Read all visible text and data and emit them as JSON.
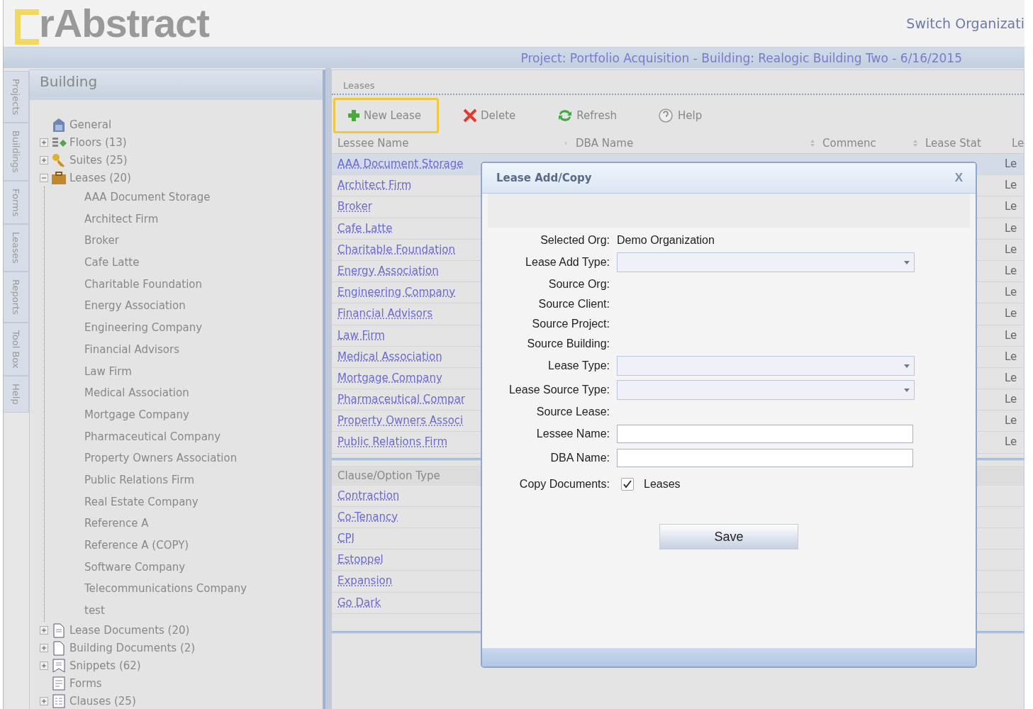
{
  "header": {
    "logo": "rAbstract",
    "switch_link": "Switch Organizati"
  },
  "project_bar": {
    "text": "Project: Portfolio Acquisition - Building: Realogic Building Two - 6/16/2015"
  },
  "side_tabs": [
    {
      "label": "Projects",
      "selected": false
    },
    {
      "label": "Buildings",
      "selected": false
    },
    {
      "label": "Forms",
      "selected": false
    },
    {
      "label": "Leases",
      "selected": false
    },
    {
      "label": "Reports",
      "selected": false
    },
    {
      "label": "Tool Box",
      "selected": false
    },
    {
      "label": "Help",
      "selected": false
    }
  ],
  "building_panel": {
    "title": "Building",
    "tree": [
      {
        "label": "General"
      },
      {
        "label": "Floors (13)",
        "expanded": false
      },
      {
        "label": "Suites (25)",
        "expanded": false
      },
      {
        "label": "Leases (20)",
        "expanded": true,
        "children": [
          {
            "label": "AAA Document Storage"
          },
          {
            "label": "Architect Firm"
          },
          {
            "label": "Broker"
          },
          {
            "label": "Cafe Latte"
          },
          {
            "label": "Charitable Foundation"
          },
          {
            "label": "Energy Association"
          },
          {
            "label": "Engineering Company"
          },
          {
            "label": "Financial Advisors"
          },
          {
            "label": "Law Firm"
          },
          {
            "label": "Medical Association"
          },
          {
            "label": "Mortgage Company"
          },
          {
            "label": "Pharmaceutical Company"
          },
          {
            "label": "Property Owners Association"
          },
          {
            "label": "Public Relations Firm"
          },
          {
            "label": "Real Estate Company"
          },
          {
            "label": "Reference A"
          },
          {
            "label": "Reference A (COPY)"
          },
          {
            "label": "Software Company"
          },
          {
            "label": "Telecommunications Company"
          },
          {
            "label": "test"
          }
        ]
      },
      {
        "label": "Lease Documents (20)",
        "expanded": false
      },
      {
        "label": "Building Documents (2)",
        "expanded": false
      },
      {
        "label": "Snippets (62)",
        "expanded": false
      },
      {
        "label": "Forms"
      },
      {
        "label": "Clauses (25)",
        "expanded": false
      }
    ]
  },
  "leases_panel": {
    "title": "Leases",
    "toolbar": [
      {
        "label": "New Lease",
        "highlighted": true
      },
      {
        "label": "Delete",
        "highlighted": false
      },
      {
        "label": "Refresh",
        "highlighted": false
      },
      {
        "label": "Help",
        "highlighted": false
      }
    ],
    "columns": [
      "Lessee Name",
      "DBA Name",
      "Commenc",
      "Lease Stat",
      "Le"
    ],
    "rows": [
      {
        "lessee": "AAA Document Storage",
        "column_5": "Le",
        "selected": true
      },
      {
        "lessee": "Architect Firm",
        "column_5": "Le",
        "selected": false
      },
      {
        "lessee": "Broker",
        "column_5": "Le",
        "selected": false
      },
      {
        "lessee": "Cafe Latte",
        "column_5": "Le",
        "selected": false
      },
      {
        "lessee": "Charitable Foundation",
        "column_5": "Le",
        "selected": false
      },
      {
        "lessee": "Energy Association",
        "column_5": "Le",
        "selected": false
      },
      {
        "lessee": "Engineering Company",
        "column_5": "Le",
        "selected": false
      },
      {
        "lessee": "Financial Advisors",
        "column_5": "Le",
        "selected": false
      },
      {
        "lessee": "Law Firm",
        "column_5": "Le",
        "selected": false
      },
      {
        "lessee": "Medical Association",
        "column_5": "Le",
        "selected": false
      },
      {
        "lessee": "Mortgage Company",
        "column_5": "Le",
        "selected": false
      },
      {
        "lessee": "Pharmaceutical Compar",
        "column_5": "Le",
        "selected": false
      },
      {
        "lessee": "Property Owners Associ",
        "column_5": "Le",
        "selected": false
      },
      {
        "lessee": "Public Relations Firm",
        "column_5": "Le",
        "selected": false
      }
    ],
    "clause_grid": {
      "column": "Clause/Option Type",
      "rows": [
        "Contraction",
        "Co-Tenancy",
        "CPI",
        "Estoppel",
        "Expansion",
        "Go Dark"
      ]
    }
  },
  "dialog": {
    "title": "Lease Add/Copy",
    "close": "X",
    "fields": [
      {
        "kind": "text",
        "label": "Selected Org:",
        "value": "Demo Organization"
      },
      {
        "kind": "select",
        "label": "Lease Add Type:"
      },
      {
        "kind": "text",
        "label": "Source Org:"
      },
      {
        "kind": "text",
        "label": "Source Client:"
      },
      {
        "kind": "text",
        "label": "Source Project:"
      },
      {
        "kind": "text",
        "label": "Source Building:"
      },
      {
        "kind": "select",
        "label": "Lease Type:"
      },
      {
        "kind": "select",
        "label": "Lease Source Type:"
      },
      {
        "kind": "text",
        "label": "Source Lease:"
      },
      {
        "kind": "input",
        "label": "Lessee Name:"
      },
      {
        "kind": "input",
        "label": "DBA Name:"
      },
      {
        "kind": "checkbox",
        "label": "Copy Documents:",
        "option": "Leases",
        "checked": true
      }
    ],
    "save": "Save"
  }
}
